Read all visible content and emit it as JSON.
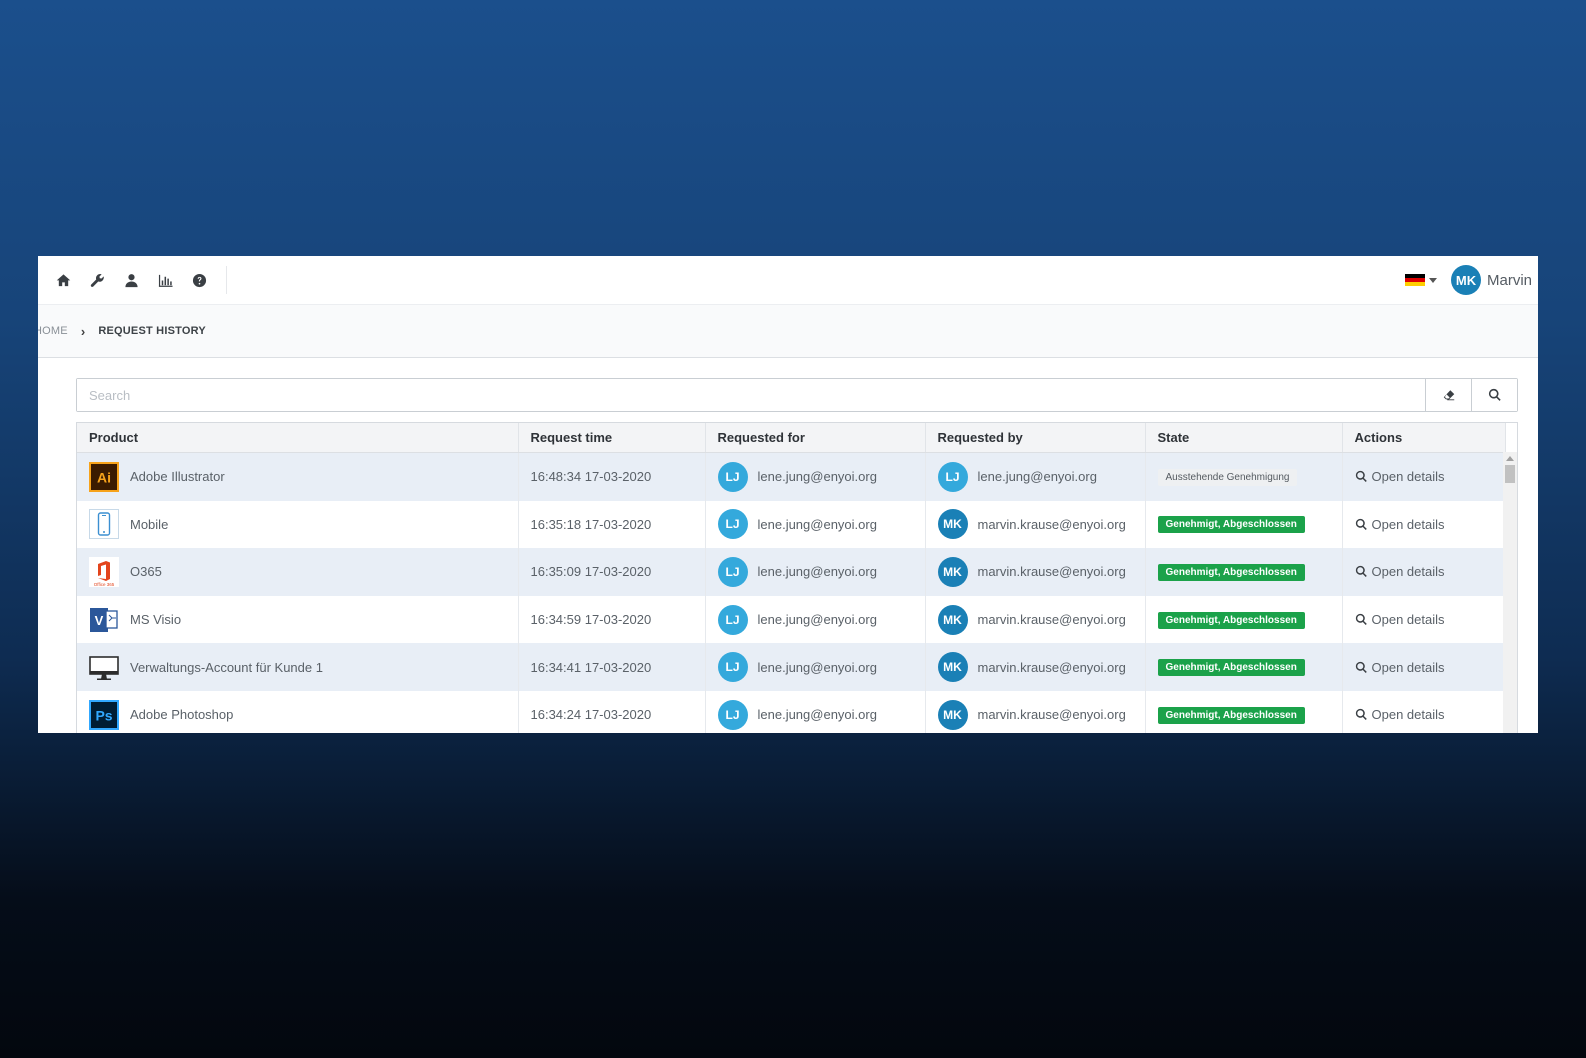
{
  "header": {
    "nav_icons": [
      "home-icon",
      "wrench-icon",
      "user-icon",
      "bar-chart-icon",
      "help-icon"
    ],
    "language_flag": "de",
    "user": {
      "initials": "MK",
      "name": "Marvin"
    }
  },
  "breadcrumb": {
    "home": "HOME",
    "current": "REQUEST HISTORY"
  },
  "search": {
    "placeholder": "Search"
  },
  "table": {
    "columns": [
      "Product",
      "Request time",
      "Requested for",
      "Requested by",
      "State",
      "Actions"
    ],
    "rows": [
      {
        "product": "Adobe Illustrator",
        "icon": "illustrator-icon",
        "time": "16:48:34 17-03-2020",
        "for_initials": "LJ",
        "for_email": "lene.jung@enyoi.org",
        "by_initials": "LJ",
        "by_email": "lene.jung@enyoi.org",
        "state": "Ausstehende Genehmigung",
        "state_type": "pending",
        "action": "Open details"
      },
      {
        "product": "Mobile",
        "icon": "mobile-icon",
        "time": "16:35:18 17-03-2020",
        "for_initials": "LJ",
        "for_email": "lene.jung@enyoi.org",
        "by_initials": "MK",
        "by_email": "marvin.krause@enyoi.org",
        "state": "Genehmigt, Abgeschlossen",
        "state_type": "approved",
        "action": "Open details"
      },
      {
        "product": "O365",
        "icon": "office365-icon",
        "time": "16:35:09 17-03-2020",
        "for_initials": "LJ",
        "for_email": "lene.jung@enyoi.org",
        "by_initials": "MK",
        "by_email": "marvin.krause@enyoi.org",
        "state": "Genehmigt, Abgeschlossen",
        "state_type": "approved",
        "action": "Open details"
      },
      {
        "product": "MS Visio",
        "icon": "visio-icon",
        "time": "16:34:59 17-03-2020",
        "for_initials": "LJ",
        "for_email": "lene.jung@enyoi.org",
        "by_initials": "MK",
        "by_email": "marvin.krause@enyoi.org",
        "state": "Genehmigt, Abgeschlossen",
        "state_type": "approved",
        "action": "Open details"
      },
      {
        "product": "Verwaltungs-Account für Kunde 1",
        "icon": "monitor-icon",
        "time": "16:34:41 17-03-2020",
        "for_initials": "LJ",
        "for_email": "lene.jung@enyoi.org",
        "by_initials": "MK",
        "by_email": "marvin.krause@enyoi.org",
        "state": "Genehmigt, Abgeschlossen",
        "state_type": "approved",
        "action": "Open details"
      },
      {
        "product": "Adobe Photoshop",
        "icon": "photoshop-icon",
        "time": "16:34:24 17-03-2020",
        "for_initials": "LJ",
        "for_email": "lene.jung@enyoi.org",
        "by_initials": "MK",
        "by_email": "marvin.krause@enyoi.org",
        "state": "Genehmigt, Abgeschlossen",
        "state_type": "approved",
        "action": "Open details"
      }
    ]
  },
  "colors": {
    "accent": "#1a80b6",
    "avatar_lj": "#34a9dc",
    "approved": "#1ba24a",
    "row_alt": "#e8eef6"
  }
}
